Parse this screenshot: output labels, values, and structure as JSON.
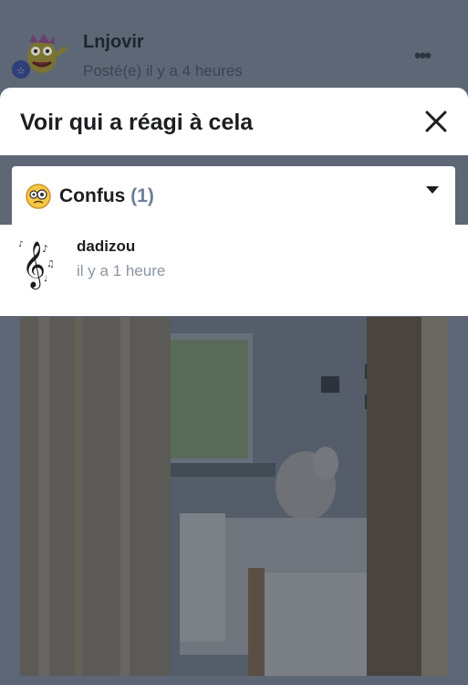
{
  "post": {
    "author": "Lnjovir",
    "time": "Posté(e) il y a 4 heures",
    "menu_icon": "more-icon"
  },
  "dialog": {
    "title": "Voir qui a réagi à cela",
    "close_icon": "close-icon",
    "filter": {
      "emoji": "confused-emoji-icon",
      "label": "Confus",
      "count": "(1)",
      "caret_icon": "caret-down-icon"
    },
    "users": [
      {
        "name": "dadizou",
        "time": "il y a 1 heure",
        "avatar": "music-note-avatar"
      }
    ]
  },
  "colors": {
    "overlay": "#5e6775",
    "panel": "#ffffff",
    "muted": "#8b94a1",
    "count": "#6e7f98"
  }
}
